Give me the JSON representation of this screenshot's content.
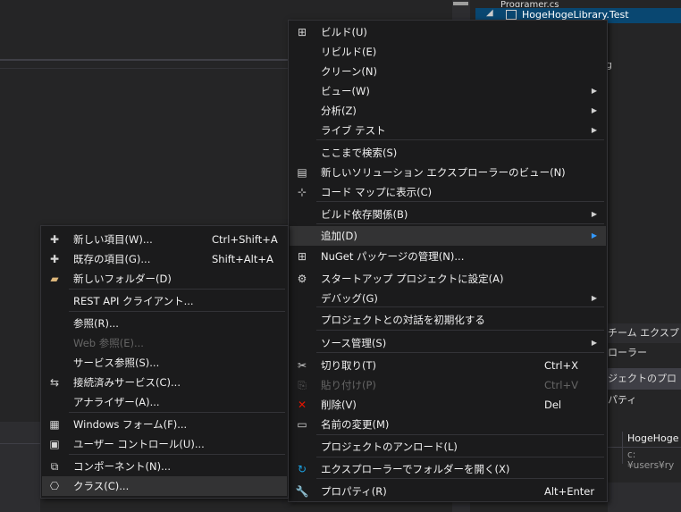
{
  "background": {
    "tree_top_fragment": "Programer.cs",
    "tree_selected": "HogeHogeLibrary.Test",
    "right_fragment": "g",
    "team_explorer_tab": "チーム エクスプローラー",
    "properties_tab": "ジェクトのプロパティ",
    "property_value_1": "HogeHoge",
    "property_value_2": "c:¥users¥ry"
  },
  "colors": {
    "menu_bg": "#1b1b1c",
    "highlight": "#333334",
    "selection_blue": "#094771",
    "delete_red": "#e51400",
    "refresh_blue": "#1ba1e2",
    "folder_yellow": "#dcb67a"
  },
  "main_menu": {
    "items": [
      {
        "label": "ビルド(U)",
        "icon": "build-icon",
        "glyph": "⊞"
      },
      {
        "label": "リビルド(E)"
      },
      {
        "label": "クリーン(N)"
      },
      {
        "label": "ビュー(W)",
        "submenu": true
      },
      {
        "label": "分析(Z)",
        "submenu": true
      },
      {
        "label": "ライブ テスト",
        "submenu": true
      },
      {
        "label": "ここまで検索(S)"
      },
      {
        "label": "新しいソリューション エクスプローラーのビュー(N)",
        "icon": "new-view-icon",
        "glyph": "▤"
      },
      {
        "label": "コード マップに表示(C)",
        "icon": "code-map-icon",
        "glyph": "⊹"
      },
      {
        "label": "ビルド依存関係(B)",
        "submenu": true
      },
      {
        "label": "追加(D)",
        "submenu": true,
        "highlighted": true
      },
      {
        "label": "NuGet パッケージの管理(N)...",
        "icon": "nuget-icon",
        "glyph": "⊞"
      },
      {
        "label": "スタートアップ プロジェクトに設定(A)",
        "icon": "gear-icon",
        "glyph": "⚙"
      },
      {
        "label": "デバッグ(G)",
        "submenu": true
      },
      {
        "label": "プロジェクトとの対話を初期化する"
      },
      {
        "label": "ソース管理(S)",
        "submenu": true
      },
      {
        "label": "切り取り(T)",
        "shortcut": "Ctrl+X",
        "icon": "cut-icon",
        "glyph": "✂"
      },
      {
        "label": "貼り付け(P)",
        "shortcut": "Ctrl+V",
        "icon": "paste-icon",
        "glyph": "⎘",
        "disabled": true
      },
      {
        "label": "削除(V)",
        "shortcut": "Del",
        "icon": "delete-icon",
        "glyph": "✕"
      },
      {
        "label": "名前の変更(M)",
        "icon": "rename-icon",
        "glyph": "▭"
      },
      {
        "label": "プロジェクトのアンロード(L)"
      },
      {
        "label": "エクスプローラーでフォルダーを開く(X)",
        "icon": "refresh-icon",
        "glyph": "↻"
      },
      {
        "label": "プロパティ(R)",
        "shortcut": "Alt+Enter",
        "icon": "wrench-icon",
        "glyph": "🔧"
      }
    ]
  },
  "add_submenu": {
    "items": [
      {
        "label": "新しい項目(W)...",
        "shortcut": "Ctrl+Shift+A",
        "icon": "new-item-icon",
        "glyph": "✚"
      },
      {
        "label": "既存の項目(G)...",
        "shortcut": "Shift+Alt+A",
        "icon": "existing-item-icon",
        "glyph": "✚"
      },
      {
        "label": "新しいフォルダー(D)",
        "icon": "folder-icon",
        "glyph": "▰"
      },
      {
        "label": "REST API クライアント..."
      },
      {
        "label": "参照(R)..."
      },
      {
        "label": "Web 参照(E)...",
        "disabled": true
      },
      {
        "label": "サービス参照(S)..."
      },
      {
        "label": "接続済みサービス(C)...",
        "icon": "connected-service-icon",
        "glyph": "⇆"
      },
      {
        "label": "アナライザー(A)..."
      },
      {
        "label": "Windows フォーム(F)...",
        "icon": "windows-form-icon",
        "glyph": "▦"
      },
      {
        "label": "ユーザー コントロール(U)...",
        "icon": "user-control-icon",
        "glyph": "▣"
      },
      {
        "label": "コンポーネント(N)...",
        "icon": "component-icon",
        "glyph": "⧉"
      },
      {
        "label": "クラス(C)...",
        "icon": "class-icon",
        "glyph": "⎔",
        "highlighted": true
      }
    ]
  }
}
